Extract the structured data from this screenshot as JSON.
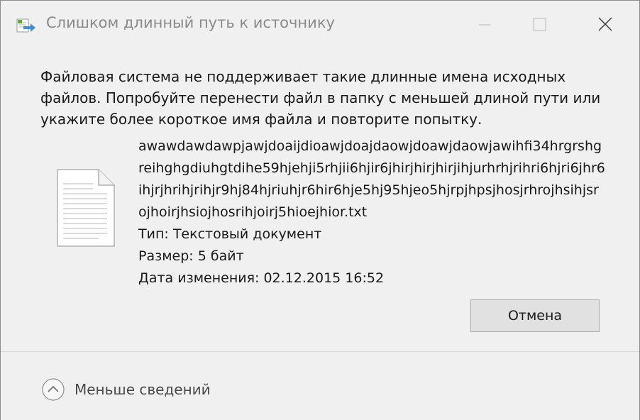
{
  "window": {
    "title": "Слишком длинный путь к источнику"
  },
  "message": "Файловая система не поддерживает такие длинные имена исходных файлов. Попробуйте перенести файл в папку с меньшей длиной пути или укажите более короткое имя файла и повторите попытку.",
  "file": {
    "name": "awawdawdawpjawjdoaijdioawjdoajdaowjdoawjdaowjawihfi34hrgrshgreihghgdiuhgtdihe59hjehji5rhjii6hjir6jhirjhirjhirjihjurhrhjrihri6hjri6jhr6ihjrjhrihjrihjr9hj84hjriuhjr6hir6hje5hj95hjeo5hjrpjhpsjhosjrhrojhsihjsrojhoirjhsiojhosrihjoirj5hioejhior.txt",
    "type": "Тип: Текстовый документ",
    "size": "Размер: 5 байт",
    "modified": "Дата изменения: 02.12.2015 16:52"
  },
  "buttons": {
    "cancel": "Отмена"
  },
  "footer": {
    "less_details": "Меньше сведений"
  },
  "icons": {
    "app": "file-move-icon",
    "file": "text-document-icon",
    "toggle": "chevron-up-circle-icon"
  },
  "colors": {
    "background": "#f0f0f0",
    "button": "#e1e1e1",
    "title_text": "#8a8a8a",
    "app_icon_accent": "#3f8fd8"
  }
}
